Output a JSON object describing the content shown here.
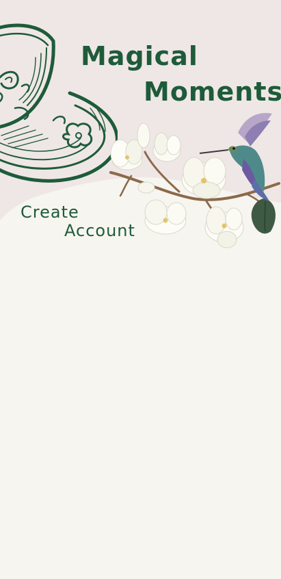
{
  "app": {
    "title_line_1": "Magical",
    "title_line_2": "Moments"
  },
  "screen": {
    "heading_line_1": "Create",
    "heading_line_2": "Account"
  },
  "illustrations": {
    "teacup": "teacup-engraving",
    "branch": "magnolia-branch",
    "bird": "hummingbird"
  },
  "colors": {
    "brand_green": "#1e5b3a",
    "header_bg": "#efe7e5",
    "page_bg": "#f7f5f0"
  }
}
